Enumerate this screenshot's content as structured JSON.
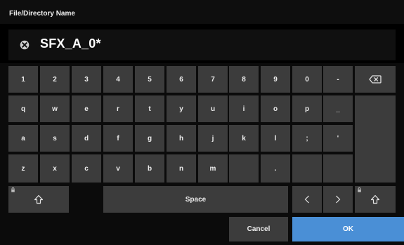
{
  "dialog": {
    "title": "File/Directory Name",
    "name_value": "SFX_A_0*"
  },
  "keys": {
    "r1": [
      "1",
      "2",
      "3",
      "4",
      "5",
      "6",
      "7",
      "8",
      "9",
      "0",
      "-"
    ],
    "r2": [
      "q",
      "w",
      "e",
      "r",
      "t",
      "y",
      "u",
      "i",
      "o",
      "p",
      "_"
    ],
    "r3": [
      "a",
      "s",
      "d",
      "f",
      "g",
      "h",
      "j",
      "k",
      "l",
      ";",
      "'"
    ],
    "r4": [
      "z",
      "x",
      "c",
      "v",
      "b",
      "n",
      "m",
      "",
      ".",
      "",
      ""
    ]
  },
  "controls": {
    "space_label": "Space",
    "cancel_label": "Cancel",
    "ok_label": "OK"
  },
  "icons": {
    "clear": "clear-icon",
    "backspace": "backspace-icon",
    "shift": "shift-icon",
    "lock": "lock-icon",
    "left": "arrow-left-icon",
    "right": "arrow-right-icon"
  },
  "colors": {
    "key": "#3c3c3c",
    "accent": "#4a8fd6"
  }
}
